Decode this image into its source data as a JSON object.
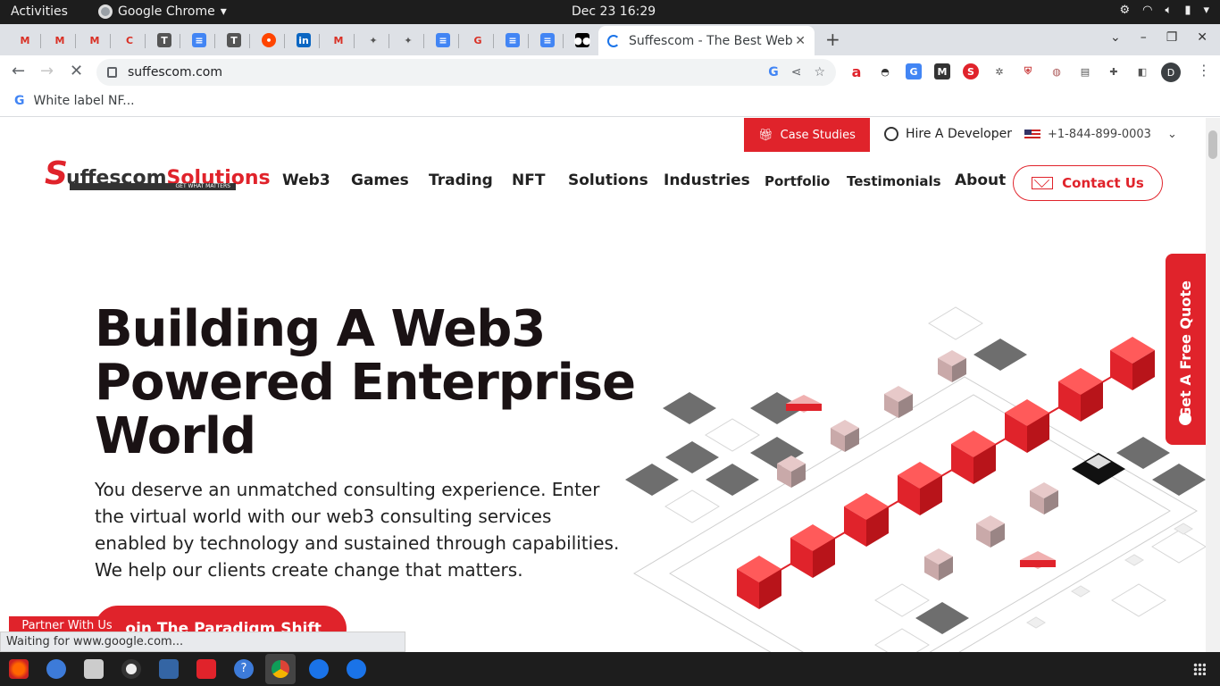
{
  "system": {
    "activities": "Activities",
    "app_name": "Google Chrome",
    "clock": "Dec 23  16:29"
  },
  "browser": {
    "active_tab_title": "Suffescom - The Best Web",
    "url": "suffescom.com",
    "bookmark_label": "White label NF...",
    "profile_initial": "D",
    "status_text": "Waiting for www.google.com..."
  },
  "site": {
    "logo": {
      "s": "S",
      "part1": "uffescom",
      "part2": "Solutions",
      "tagline": "GET WHAT MATTERS"
    },
    "topbar": {
      "case_studies": "Case Studies",
      "hire": "Hire A Developer",
      "phone": "+1-844-899-0003"
    },
    "nav": [
      "Web3",
      "Games",
      "Trading",
      "NFT",
      "Solutions",
      "Industries",
      "Portfolio",
      "Testimonials",
      "About"
    ],
    "contact": "Contact Us",
    "hero": {
      "line1": "Building A Web3",
      "line2": "Powered Enterprise",
      "line3": "World",
      "desc1": "You deserve an unmatched consulting experience. Enter",
      "desc2": "the virtual world with our web3 consulting services",
      "desc3": "enabled by technology and sustained through capabilities.",
      "desc4": "We help our clients create change that matters.",
      "cta": "Join The Paradigm Shift",
      "partner": "Partner With Us"
    },
    "quote_tab": "Get A Free Quote"
  },
  "colors": {
    "brand_red": "#e0232b",
    "dark": "#1a1214"
  }
}
